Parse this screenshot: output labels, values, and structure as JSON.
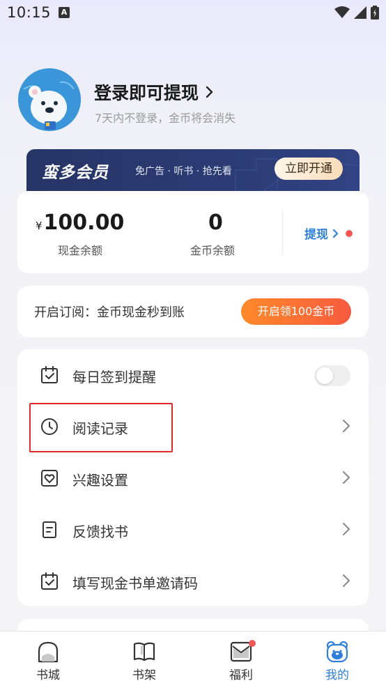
{
  "status_bar": {
    "time": "10:15",
    "notification_badge": "A"
  },
  "profile": {
    "login_title": "登录即可提现",
    "login_subtitle": "7天内不登录，金币将会消失"
  },
  "vip": {
    "logo": "蛮多会员",
    "description": "免广告 · 听书 · 抢先看",
    "button": "立即开通"
  },
  "wallet": {
    "currency_symbol": "¥",
    "cash_amount": "100.00",
    "cash_label": "现金余额",
    "coin_amount": "0",
    "coin_label": "金币余额",
    "withdraw_label": "提现"
  },
  "subscribe": {
    "text": "开启订阅：金币现金秒到账",
    "button": "开启领100金币"
  },
  "menu": {
    "items": [
      {
        "label": "每日签到提醒",
        "icon": "calendar-check-icon",
        "control": "toggle",
        "toggle_on": false
      },
      {
        "label": "阅读记录",
        "icon": "clock-icon",
        "control": "chevron"
      },
      {
        "label": "兴趣设置",
        "icon": "heart-frame-icon",
        "control": "chevron"
      },
      {
        "label": "反馈找书",
        "icon": "document-icon",
        "control": "chevron"
      },
      {
        "label": "填写现金书单邀请码",
        "icon": "calendar-check-icon",
        "control": "chevron"
      }
    ]
  },
  "tabbar": {
    "tabs": [
      {
        "label": "书城",
        "icon": "bookstore-icon",
        "active": false
      },
      {
        "label": "书架",
        "icon": "bookshelf-icon",
        "active": false
      },
      {
        "label": "福利",
        "icon": "gift-mail-icon",
        "active": false,
        "badge_dot": true
      },
      {
        "label": "我的",
        "icon": "bear-face-icon",
        "active": true
      }
    ]
  },
  "colors": {
    "accent_blue": "#2f7fd8",
    "badge_red": "#f05656",
    "highlight_red": "#e02828",
    "subscribe_orange": "#ff7a32",
    "vip_navy": "#2c3b74"
  }
}
